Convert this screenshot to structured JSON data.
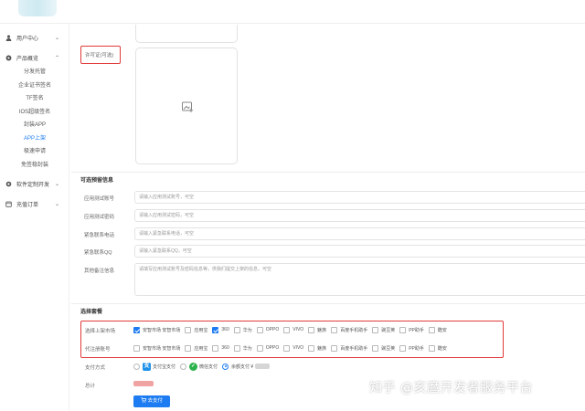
{
  "sidebar": {
    "groups": [
      {
        "label": "用户中心",
        "icon": "user-icon"
      },
      {
        "label": "产品概览",
        "icon": "product-icon"
      },
      {
        "label": "软件定制开发",
        "icon": "gear-icon"
      },
      {
        "label": "充值订单",
        "icon": "order-icon"
      }
    ],
    "sub_items": [
      "分发托管",
      "企业证书签名",
      "TF签名",
      "IOS超级签名",
      "封装APP",
      "APP上架",
      "极速申请",
      "免签稳封装"
    ],
    "active_sub": "APP上架"
  },
  "license": {
    "label": "许可证(可选)"
  },
  "optional_info": {
    "title": "可选预留信息",
    "fields": [
      {
        "label": "应用测试账号",
        "placeholder": "请输入应用测试账号，可空"
      },
      {
        "label": "应用测试密码",
        "placeholder": "请输入应用测试密码，可空"
      },
      {
        "label": "紧急联系电话",
        "placeholder": "请输入紧急联系电话，可空"
      },
      {
        "label": "紧急联系QQ",
        "placeholder": "请输入紧急联系QQ，可空"
      }
    ],
    "remark": {
      "label": "其他备注信息",
      "placeholder": "请填写应用测试账号及密码信息等，供我们提交上架的信息，可空"
    }
  },
  "package": {
    "title": "选择套餐",
    "market_row": {
      "label": "选择上架市场",
      "options": [
        {
          "label": "安智市场 安智市场",
          "checked": true
        },
        {
          "label": "应用宝",
          "checked": false
        },
        {
          "label": "360",
          "checked": true
        },
        {
          "label": "华为",
          "checked": false
        },
        {
          "label": "OPPO",
          "checked": false
        },
        {
          "label": "VIVO",
          "checked": false
        },
        {
          "label": "魅族",
          "checked": false
        },
        {
          "label": "百度手机助手",
          "checked": false
        },
        {
          "label": "豌豆荚",
          "checked": false
        },
        {
          "label": "PP助手",
          "checked": false
        },
        {
          "label": "酷安",
          "checked": false
        }
      ]
    },
    "account_row": {
      "label": "代注册账号",
      "options": [
        {
          "label": "安智市场 安智市场",
          "checked": false
        },
        {
          "label": "应用宝",
          "checked": false
        },
        {
          "label": "360",
          "checked": false
        },
        {
          "label": "华为",
          "checked": false
        },
        {
          "label": "OPPO",
          "checked": false
        },
        {
          "label": "VIVO",
          "checked": false
        },
        {
          "label": "魅族",
          "checked": false
        },
        {
          "label": "百度手机助手",
          "checked": false
        },
        {
          "label": "豌豆荚",
          "checked": false
        },
        {
          "label": "PP助手",
          "checked": false
        },
        {
          "label": "酷安",
          "checked": false
        }
      ]
    }
  },
  "payment": {
    "label": "支付方式",
    "options": [
      {
        "label": "支付宝支付",
        "icon": "alipay-icon",
        "selected": false
      },
      {
        "label": "微信支付",
        "icon": "wechat-icon",
        "selected": false
      },
      {
        "label": "余额支付 ¥",
        "icon": "",
        "selected": true
      }
    ],
    "total_label": "总计",
    "button": "去支付"
  },
  "watermark": "知乎 @亥麿开发者服务平台",
  "colors": {
    "accent": "#1e7cf2",
    "highlight": "#e13a3a"
  }
}
